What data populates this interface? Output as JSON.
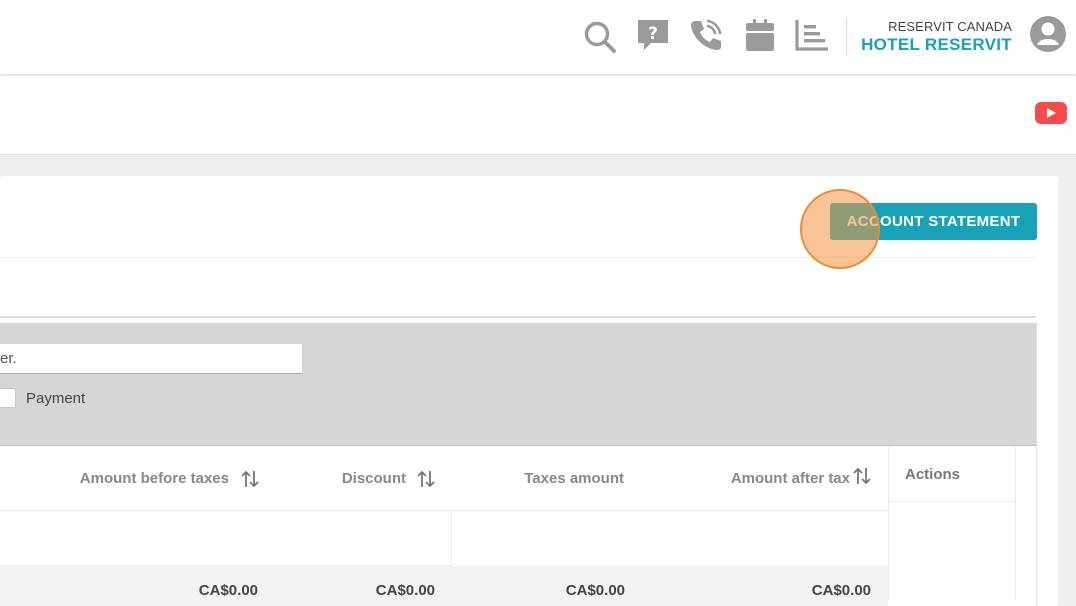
{
  "header": {
    "icons": [
      "search-icon",
      "help-chat-icon",
      "phone-icon",
      "calendar-icon",
      "report-icon",
      "user-avatar-icon"
    ],
    "company_name": "RESERVIT CANADA",
    "hotel_name": "HOTEL RESERVIT"
  },
  "subbar": {
    "youtube_icon": "youtube-icon"
  },
  "card": {
    "account_statement_label": "ACCOUNT STATEMENT"
  },
  "filters": {
    "search_value": "er.",
    "payment_label": "Payment"
  },
  "table": {
    "columns": [
      {
        "label": "Amount before taxes",
        "sortable": true
      },
      {
        "label": "Discount",
        "sortable": true
      },
      {
        "label": "Taxes amount",
        "sortable": false
      },
      {
        "label": "Amount after tax",
        "sortable": true
      },
      {
        "label": "Actions",
        "sortable": false
      }
    ],
    "totals": [
      "CA$0.00",
      "CA$0.00",
      "CA$0.00",
      "CA$0.00"
    ]
  },
  "colors": {
    "accent": "#17a2b8",
    "icon_gray": "#9a9a9a",
    "youtube_red": "#f54b4b",
    "filter_panel": "#d5d5d5"
  }
}
